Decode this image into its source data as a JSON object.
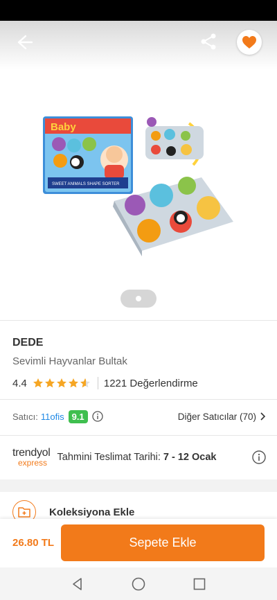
{
  "icons": {
    "back": "arrow-left-icon",
    "share": "share-icon",
    "favorite": "heart-icon",
    "info": "info-icon",
    "chevron": "chevron-right-icon",
    "collection": "folder-plus-icon",
    "nav_back": "triangle-back-icon",
    "nav_home": "circle-home-icon",
    "nav_recents": "square-recents-icon"
  },
  "colors": {
    "accent": "#f27a1a",
    "seller_score_bg": "#3fbf4f",
    "seller_link": "#1e88e5",
    "star": "#f6a623"
  },
  "product": {
    "brand": "DEDE",
    "name": "Sevimli Hayvanlar Bultak",
    "rating": "4.4",
    "stars": 4.4,
    "reviews": "1221 Değerlendirme"
  },
  "seller": {
    "label": "Satıcı:",
    "name": "11ofis",
    "score": "9.1",
    "other_sellers": "Diğer Satıcılar (70)"
  },
  "delivery": {
    "logo_word": "trendyol",
    "logo_sub": "express",
    "label": "Tahmini Teslimat Tarihi:",
    "dates": "7 - 12 Ocak"
  },
  "collection": {
    "label": "Koleksiyona Ekle"
  },
  "purchase": {
    "price": "26.80 TL",
    "button": "Sepete Ekle"
  },
  "box": {
    "title": "Baby",
    "subtitle": "SWEET ANIMALS SHAPE SORTER"
  }
}
